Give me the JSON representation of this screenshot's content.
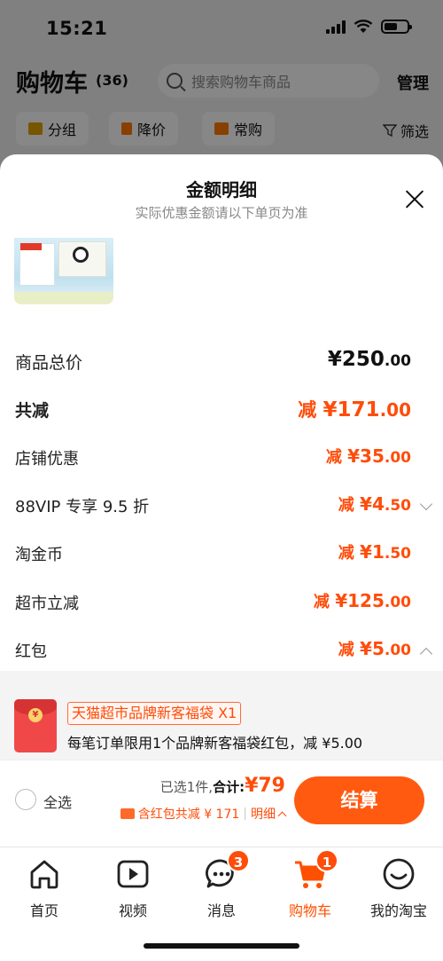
{
  "status": {
    "time": "15:21"
  },
  "header": {
    "title": "购物车",
    "count": "(36)",
    "search_placeholder": "搜索购物车商品",
    "manage": "管理"
  },
  "filters": {
    "group": "分组",
    "price_drop": "降价",
    "frequent": "常购",
    "filter": "筛选"
  },
  "sheet": {
    "title": "金额明细",
    "subtitle": "实际优惠金额请以下单页为准",
    "rows": [
      {
        "label": "商品总价",
        "prefix": "",
        "yuan": "¥250",
        "cents": ".00"
      },
      {
        "label": "共减",
        "prefix": "减 ",
        "yuan": "¥171",
        "cents": ".00"
      },
      {
        "label": "店铺优惠",
        "prefix": "减 ",
        "yuan": "¥35",
        "cents": ".00"
      },
      {
        "label": "88VIP 专享 9.5 折",
        "prefix": "减 ",
        "yuan": "¥4",
        "cents": ".50"
      },
      {
        "label": "淘金币",
        "prefix": "减 ",
        "yuan": "¥1",
        "cents": ".50"
      },
      {
        "label": "超市立减",
        "prefix": "减 ",
        "yuan": "¥125",
        "cents": ".00"
      },
      {
        "label": "红包",
        "prefix": "减 ",
        "yuan": "¥5",
        "cents": ".00"
      }
    ],
    "redpacket": {
      "tag": "天猫超市品牌新客福袋 X1",
      "desc": "每笔订单限用1个品牌新客福袋红包，减 ¥5.00",
      "coin": "¥"
    }
  },
  "checkout": {
    "select_all": "全选",
    "selected": "已选1件,",
    "total_label": "合计:",
    "total_amount": "¥79",
    "discount": "含红包共减 ¥ 171",
    "detail": "明细",
    "pay": "结算"
  },
  "tabs": [
    {
      "label": "首页",
      "badge": ""
    },
    {
      "label": "视频",
      "badge": ""
    },
    {
      "label": "消息",
      "badge": "3"
    },
    {
      "label": "购物车",
      "badge": "1"
    },
    {
      "label": "我的淘宝",
      "badge": ""
    }
  ],
  "colors": {
    "accent": "#ff5000",
    "price": "#ff4c0a"
  }
}
